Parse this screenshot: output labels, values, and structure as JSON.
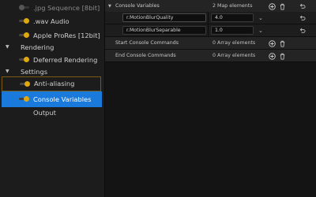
{
  "left_panel": {
    "items": [
      {
        "label": ".jpg Sequence [8bit]",
        "toggle": "off",
        "faded": true
      },
      {
        "label": ".wav Audio",
        "toggle": "on"
      },
      {
        "label": "Apple ProRes [12bit]",
        "toggle": "on"
      },
      {
        "category": "Rendering"
      },
      {
        "label": "Deferred Rendering",
        "toggle": "on"
      },
      {
        "category": "Settings"
      },
      {
        "label": "Anti-aliasing",
        "toggle": "on",
        "outlined": true
      },
      {
        "label": "Console Variables",
        "toggle": "on",
        "selected": true
      },
      {
        "label": "Output"
      }
    ]
  },
  "details": {
    "console_variables": {
      "label": "Console Variables",
      "count": "2 Map elements",
      "entries": [
        {
          "key": "r.MotionBlurQuality",
          "value": "4.0"
        },
        {
          "key": "r.MotionBlurSeparable",
          "value": "1.0"
        }
      ]
    },
    "start_commands": {
      "label": "Start Console Commands",
      "count": "0 Array elements"
    },
    "end_commands": {
      "label": "End Console Commands",
      "count": "0 Array elements"
    }
  },
  "icons": {
    "add": "plus-circle-icon",
    "delete": "trash-icon",
    "reset": "reset-arrow-icon",
    "expand": "chevron-down-icon"
  },
  "colors": {
    "accent_toggle": "#e0a80f",
    "selection": "#1a7adb",
    "outline": "#7a5a12"
  }
}
